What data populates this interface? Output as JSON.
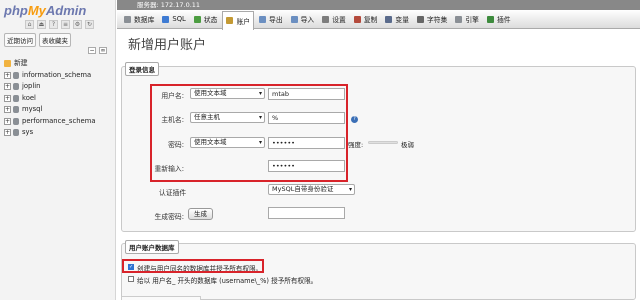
{
  "sidebar": {
    "logo": {
      "php": "php",
      "my": "My",
      "admin": "Admin"
    },
    "tabs": [
      "近期访问",
      "表收藏夹"
    ],
    "new_label": "新建",
    "databases": [
      "information_schema",
      "joplin",
      "koel",
      "mysql",
      "performance_schema",
      "sys"
    ]
  },
  "server_bar": "服务器: 172.17.0.11",
  "tabs": [
    {
      "label": "数据库",
      "icon": "database-icon",
      "color": "#8a8f95"
    },
    {
      "label": "SQL",
      "icon": "sql-icon",
      "color": "#3e7bd3"
    },
    {
      "label": "状态",
      "icon": "status-icon",
      "color": "#4c9d41"
    },
    {
      "label": "账户",
      "icon": "users-icon",
      "color": "#c49a34",
      "active": true
    },
    {
      "label": "导出",
      "icon": "export-icon",
      "color": "#6b8fc1"
    },
    {
      "label": "导入",
      "icon": "import-icon",
      "color": "#6b8fc1"
    },
    {
      "label": "设置",
      "icon": "settings-icon",
      "color": "#7d7d7d"
    },
    {
      "label": "复制",
      "icon": "replication-icon",
      "color": "#b44a3c"
    },
    {
      "label": "变量",
      "icon": "variables-icon",
      "color": "#5a6b8c"
    },
    {
      "label": "字符集",
      "icon": "charset-icon",
      "color": "#666666"
    },
    {
      "label": "引擎",
      "icon": "engines-icon",
      "color": "#8a8f95"
    },
    {
      "label": "插件",
      "icon": "plugins-icon",
      "color": "#3d8b3d"
    }
  ],
  "page_title": "新增用户账户",
  "login": {
    "legend": "登录信息",
    "username": {
      "label": "用户名:",
      "select": "使用文本域",
      "value": "mtab"
    },
    "host": {
      "label": "主机名:",
      "select": "任意主机",
      "value": "%"
    },
    "password": {
      "label": "密码:",
      "select": "使用文本域",
      "value": "••••••",
      "strength_label": "强度:",
      "strength_value": "极弱"
    },
    "retype": {
      "label": "重新输入:",
      "value": "••••••"
    },
    "auth_plugin": {
      "label": "认证插件",
      "value": "MySQL自带身份验证"
    },
    "generate": {
      "label": "生成密码:",
      "button": "生成"
    }
  },
  "userdb": {
    "legend": "用户账户数据库",
    "option1": "创建与用户同名的数据库并授予所有权限。",
    "option2_prefix": "给以 用户名_ 开头的数据库 (username\\_%) 授予所有权限。"
  },
  "colors": {
    "highlight": "#d8232a",
    "accent": "#2d72d2"
  }
}
